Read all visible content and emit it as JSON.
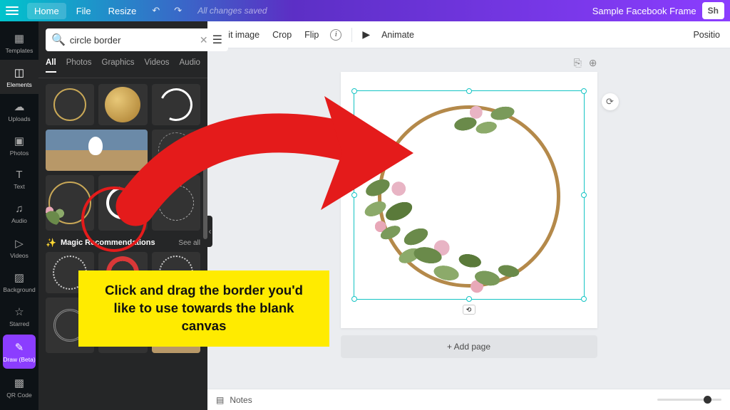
{
  "topbar": {
    "home": "Home",
    "file": "File",
    "resize": "Resize",
    "saved": "All changes saved",
    "project_name": "Sample Facebook Frame",
    "share": "Sh"
  },
  "rail": {
    "templates": "Templates",
    "elements": "Elements",
    "uploads": "Uploads",
    "photos": "Photos",
    "text": "Text",
    "audio": "Audio",
    "videos": "Videos",
    "background": "Background",
    "starred": "Starred",
    "draw_beta": "Draw (Beta)",
    "qr_code": "QR Code"
  },
  "search": {
    "value": "circle border"
  },
  "tabs": {
    "all": "All",
    "photos": "Photos",
    "graphics": "Graphics",
    "videos": "Videos",
    "audio": "Audio"
  },
  "magic": {
    "label": "Magic Recommendations",
    "see_all": "See all"
  },
  "context": {
    "edit_image": "Edit image",
    "crop": "Crop",
    "flip": "Flip",
    "animate": "Animate",
    "position": "Positio"
  },
  "canvas": {
    "add_page": "+ Add page"
  },
  "bottom": {
    "notes": "Notes"
  },
  "callout": "Click and drag the border you'd like to use towards the blank canvas",
  "colors": {
    "accent": "#8b3dff",
    "teal": "#00c4cc",
    "selection": "#14c4c4",
    "highlight": "#e41b1b"
  }
}
